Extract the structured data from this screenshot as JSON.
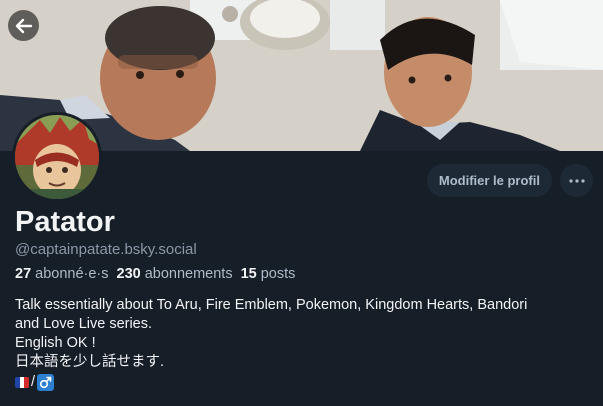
{
  "profile": {
    "display_name": "Patator",
    "handle": "@captainpatate.bsky.social"
  },
  "actions": {
    "edit_label": "Modifier le profil",
    "more_icon": "ellipsis-icon"
  },
  "stats": {
    "followers_count": "27",
    "followers_label": "abonné·e·s",
    "following_count": "230",
    "following_label": "abonnements",
    "posts_count": "15",
    "posts_label": "posts"
  },
  "bio": {
    "line1": "Talk essentially about To Aru, Fire Emblem, Pokemon, Kingdom Hearts, Bandori",
    "line2": "and Love Live series.",
    "line3": "English OK !",
    "line4": "日本語を少し話せます.",
    "separator": "/"
  },
  "colors": {
    "background": "#161e27",
    "button_bg": "#1e2936",
    "muted_text": "#8b98a8",
    "male_sign_bg": "#2c7fd1"
  }
}
